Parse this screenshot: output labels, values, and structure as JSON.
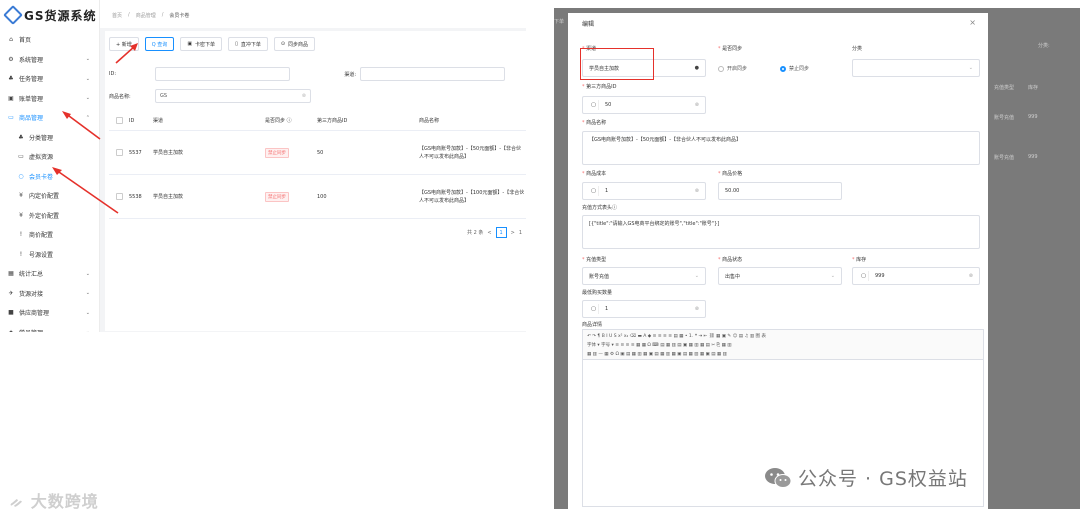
{
  "left": {
    "app_name": "GS货源系统",
    "breadcrumb": [
      "首页",
      "/",
      "商品管理",
      "/",
      "会员卡卷"
    ],
    "menu": [
      {
        "icon": "home-icon",
        "glyph": "⌂",
        "label": "首页",
        "arrow": ""
      },
      {
        "icon": "gear-icon",
        "glyph": "⚙",
        "label": "系统管理",
        "arrow": "⌄"
      },
      {
        "icon": "task-icon",
        "glyph": "♣",
        "label": "任务管理",
        "arrow": "⌄"
      },
      {
        "icon": "ledger-icon",
        "glyph": "▣",
        "label": "账单管理",
        "arrow": "⌄"
      },
      {
        "icon": "product-icon",
        "glyph": "▭",
        "label": "商品管理",
        "arrow": "⌃"
      }
    ],
    "submenu": [
      {
        "icon": "category-icon",
        "glyph": "♣",
        "label": "分类管理"
      },
      {
        "icon": "virtual-icon",
        "glyph": "▭",
        "label": "虚拟资源"
      },
      {
        "icon": "card-icon",
        "glyph": "○",
        "label": "会员卡卷"
      },
      {
        "icon": "yen-icon",
        "glyph": "¥",
        "label": "内定价配置"
      },
      {
        "icon": "yen-icon",
        "glyph": "¥",
        "label": "外定价配置"
      },
      {
        "icon": "flag-icon",
        "glyph": "!",
        "label": "商价配置"
      },
      {
        "icon": "flag-icon",
        "glyph": "!",
        "label": "号源设置"
      }
    ],
    "menu2": [
      {
        "icon": "stats-icon",
        "glyph": "▦",
        "label": "统计汇总",
        "arrow": "⌄"
      },
      {
        "icon": "source-icon",
        "glyph": "✈",
        "label": "货源对接",
        "arrow": "⌄"
      },
      {
        "icon": "supplier-icon",
        "glyph": "■",
        "label": "供应商管理",
        "arrow": "⌄"
      },
      {
        "icon": "student-icon",
        "glyph": "✦",
        "label": "学员管理",
        "arrow": "⌄"
      }
    ],
    "toolbar": {
      "add": "+ 新增",
      "search": "Q 查询",
      "card_order": "卡密下单",
      "direct_order": "直冲下单",
      "sync": "同步商品"
    },
    "filters": {
      "id_label": "ID:",
      "channel_label": "渠道:",
      "name_label": "商品名称:",
      "name_value": "GS"
    },
    "table": {
      "headers": [
        "ID",
        "渠道",
        "是否同步 ⓘ",
        "第三方商品ID",
        "商品名称"
      ],
      "rows": [
        {
          "id": "5537",
          "channel": "学员自主加款",
          "sync": "禁止同步",
          "third_id": "50",
          "name": "【GS电商账号加款】-【50元面额】-【非合伙人不可以发布此商品】"
        },
        {
          "id": "5538",
          "channel": "学员自主加款",
          "sync": "禁止同步",
          "third_id": "100",
          "name": "【GS电商账号加款】-【100元面额】-【非合伙人不可以发布此商品】"
        }
      ]
    },
    "pager": {
      "total": "共 2 条",
      "prev": "<",
      "page": "1",
      "next": ">",
      "jump": "1"
    }
  },
  "left_watermark": "大数跨境",
  "right": {
    "dialog_title": "编辑",
    "close": "×",
    "channel_label": "渠道",
    "channel_value": "学员自主加款",
    "sync_label": "是否同步",
    "sync_opts": [
      "开启同步",
      "禁止同步"
    ],
    "category_label": "分类",
    "third_id_label": "第三方商品ID",
    "third_id_value": "50",
    "name_label": "商品名称",
    "name_value": "【GS电商账号加款】-【50元面额】-【非合伙人不可以发布此商品】",
    "cost_label": "商品成本",
    "cost_value": "1",
    "price_label": "商品价格",
    "price_value": "50.00",
    "recharge_label": "充值方式表头ⓘ",
    "recharge_value": "[{\"title\":\"请输入GS电商平台绑定的账号\",\"title\":\"账号\"}]",
    "type_label": "充值类型",
    "type_value": "账号充值",
    "status_label": "商品状态",
    "status_value": "出售中",
    "stock_label": "库存",
    "stock_value": "999",
    "limit_label": "最低购买数量",
    "limit_value": "1",
    "detail_label": "商品详情",
    "editor_row1": "↶ ↷ ¶ B I U S x² x₂ ⌫ ▬ A ◆ ≡ ≡ ≡ ≡ ▤ ▦ • 1. ❝ ⇥ ⇤ ⛓ ▦ ▣ ✎ ☺ ▤ ♫ ▥ 图 表",
    "editor_row2": "字体 ▾ 字号 ▾ ≡ ≡ ≡ ≡ ▦ ▦ Ω ⌨ ▤ ▦ ▥ ▤ ▣ ▦ ▥ ▦ ▤ ✂ ⎘ ▦ ▥",
    "editor_row3": "▦ ▥ — ▦ ⚙ Ω ▣ ▤ ▦ ▥ ▦ ▣ ▤ ▦ ▥ ▦ ▣ ▤ ▦ ▥ ▦ ▣ ▤ ▦ ▥",
    "bg_texts": [
      "下单",
      "分类:",
      "充值类型",
      "库存",
      "账号充值",
      "999",
      "账号充值",
      "999"
    ]
  },
  "right_watermark": "公众号 · GS权益站"
}
